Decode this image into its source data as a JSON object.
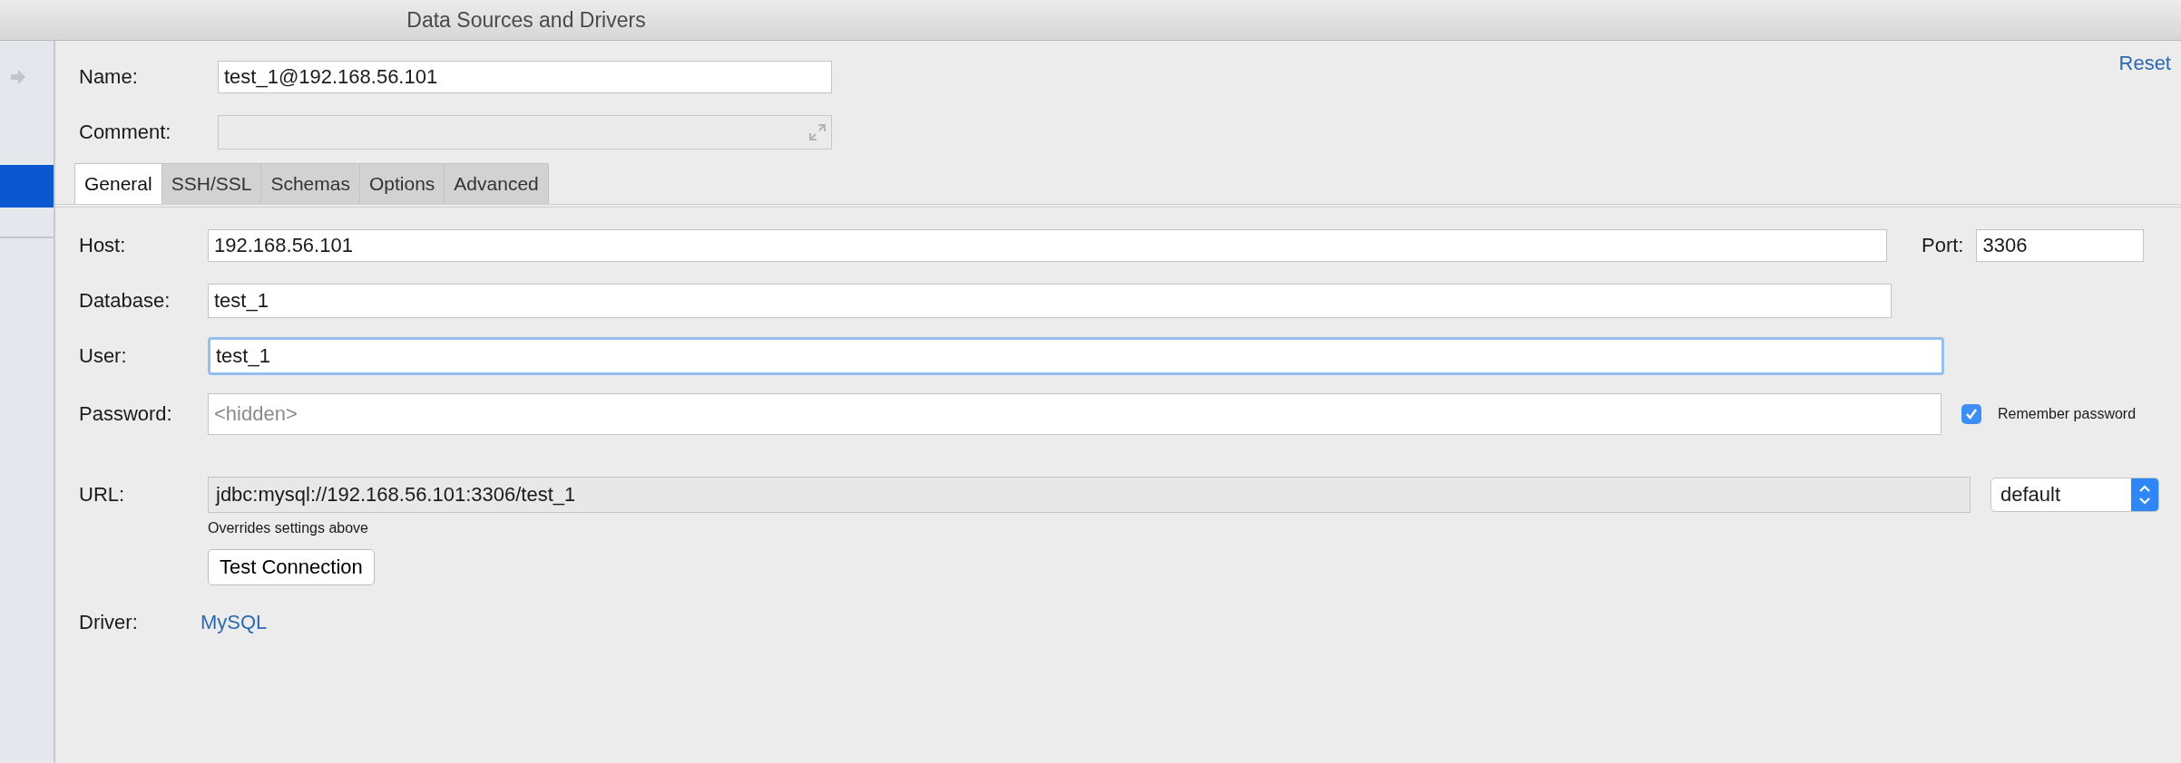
{
  "window": {
    "title": "Data Sources and Drivers"
  },
  "header": {
    "name_label": "Name:",
    "name_value": "test_1@192.168.56.101",
    "comment_label": "Comment:",
    "reset": "Reset"
  },
  "tabs": [
    {
      "label": "General",
      "selected": true
    },
    {
      "label": "SSH/SSL",
      "selected": false
    },
    {
      "label": "Schemas",
      "selected": false
    },
    {
      "label": "Options",
      "selected": false
    },
    {
      "label": "Advanced",
      "selected": false
    }
  ],
  "general": {
    "host_label": "Host:",
    "host_value": "192.168.56.101",
    "port_label": "Port:",
    "port_value": "3306",
    "database_label": "Database:",
    "database_value": "test_1",
    "user_label": "User:",
    "user_value": "test_1",
    "user_focused": true,
    "password_label": "Password:",
    "password_placeholder": "<hidden>",
    "remember_password": {
      "label": "Remember password",
      "checked": true
    },
    "url_label": "URL:",
    "url_value": "jdbc:mysql://192.168.56.101:3306/test_1",
    "url_mode": "default",
    "url_hint": "Overrides settings above",
    "test_button": "Test Connection",
    "driver_label": "Driver:",
    "driver_link": "MySQL"
  }
}
